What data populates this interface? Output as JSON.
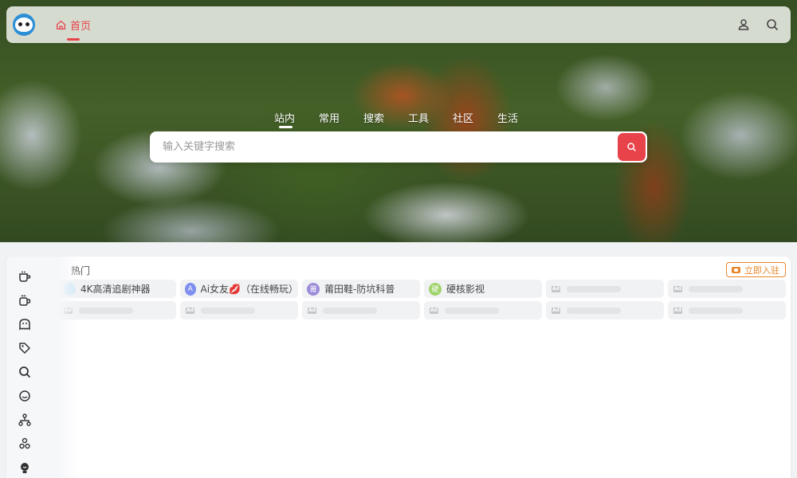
{
  "nav": {
    "home_label": "首页",
    "icons": [
      "user-icon",
      "search-icon"
    ]
  },
  "search": {
    "tabs": [
      "站内",
      "常用",
      "搜索",
      "工具",
      "社区",
      "生活"
    ],
    "active_tab": "站内",
    "placeholder": "输入关键字搜索"
  },
  "section": {
    "title": "热门",
    "join_label": "立即入驻"
  },
  "sidebar": {
    "icons": [
      "coffee-icon",
      "mug-icon",
      "ghost-icon",
      "tags-icon",
      "search-icon",
      "chat-icon",
      "sitemap-icon",
      "nodes-icon",
      "lightbulb-icon"
    ]
  },
  "links": [
    {
      "label": "4K高清追剧神器",
      "badge": "",
      "color": "#cfe9f7"
    },
    {
      "label": "Ai女友💋（在线畅玩）",
      "badge": "A",
      "color": "#7f8ff0"
    },
    {
      "label": "莆田鞋-防坑科普",
      "badge": "莆",
      "color": "#9b8bd8"
    },
    {
      "label": "硬核影视",
      "badge": "硬",
      "color": "#9fd36a"
    }
  ],
  "ad_label": "Ad",
  "colors": {
    "accent": "#e8424a",
    "join": "#e9862a"
  }
}
